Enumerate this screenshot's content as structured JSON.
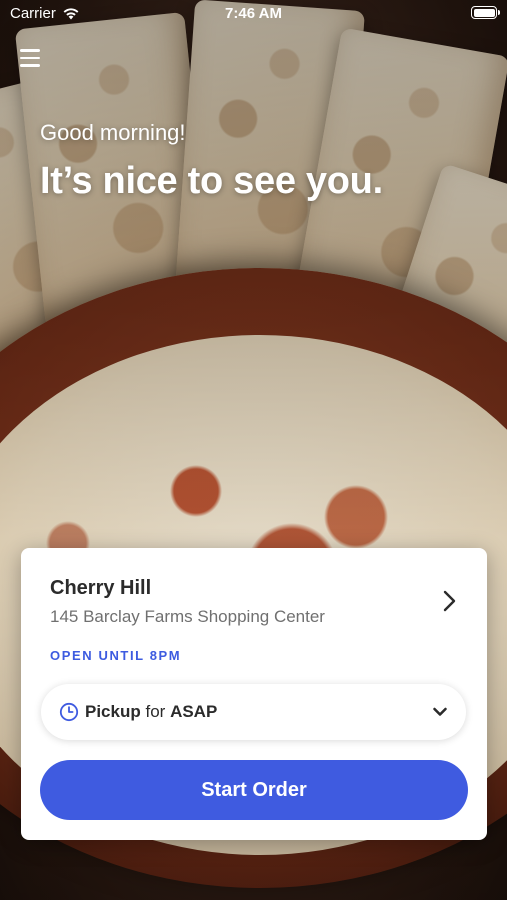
{
  "status_bar": {
    "carrier": "Carrier",
    "time": "7:46 AM",
    "icons": [
      "wifi-icon",
      "battery-icon"
    ]
  },
  "menu": {
    "icon": "hamburger-menu-icon"
  },
  "greeting": {
    "subtitle": "Good morning!",
    "title": "It’s nice to see you."
  },
  "location": {
    "name": "Cherry Hill",
    "address": "145 Barclay Farms Shopping Center",
    "hours": "OPEN UNTIL 8PM",
    "icon": "chevron-right-icon"
  },
  "order_mode": {
    "mode": "Pickup",
    "connector": "for",
    "time": "ASAP",
    "icon": "clock-icon",
    "dropdown_icon": "chevron-down-icon"
  },
  "actions": {
    "start_order": "Start Order"
  },
  "colors": {
    "accent": "#3F5BE0",
    "card_background": "#FFFFFF",
    "text_primary": "#2B2B2B",
    "text_secondary": "#707070"
  }
}
